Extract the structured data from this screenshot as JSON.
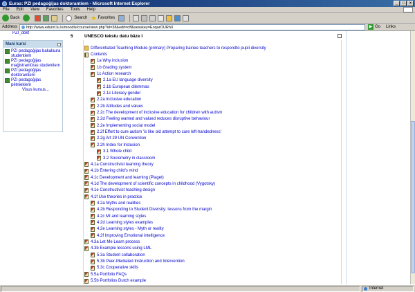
{
  "window": {
    "title": "Euras: PZI pedagoģijas doktorantiem - Microsoft Internet Explorer",
    "minimize": "_",
    "maximize": "□",
    "close": "×"
  },
  "menubar": [
    "File",
    "Edit",
    "View",
    "Favorites",
    "Tools",
    "Help"
  ],
  "toolbar": {
    "back_label": "Back",
    "search_label": "Search",
    "favorites_label": "Favorites"
  },
  "address": {
    "label": "Address",
    "url": "http://www.eduinf.lu.lv/moodle/course/view.php?id=38&edit=off&sesskey=EoqarOURhX",
    "go_label": "Go",
    "links_label": "Links"
  },
  "sidebar": {
    "top_link": "PZI_dokt",
    "block_title": "Mani kursi",
    "courses": [
      "PZI pedagoģijas bakalaura studentiem",
      "PZI pedagoģijas maģistrantūras studentiem",
      "PZI pedagoģijas doktorantiem",
      "PZI pedagoģijas pētniekiem"
    ],
    "all_courses": "Visus kursus..."
  },
  "section": {
    "number": "5",
    "title": "UNESCO tekstu datu bāze I"
  },
  "items": [
    {
      "label": "Differentiated Teaching Module (primary) Preparing trainee teachers to respondto pupil diversity",
      "indent": 0,
      "icon": "folder"
    },
    {
      "label": "Contents",
      "indent": 0,
      "icon": "book"
    },
    {
      "label": "1a Why inclusion",
      "indent": 1,
      "icon": "page"
    },
    {
      "label": "1b Grading system",
      "indent": 1,
      "icon": "page"
    },
    {
      "label": "1c Action research",
      "indent": 1,
      "icon": "page"
    },
    {
      "label": "2.1a EU language diversity",
      "indent": 2,
      "icon": "page"
    },
    {
      "label": "2.1b European dilemmas",
      "indent": 2,
      "icon": "page"
    },
    {
      "label": "2.1c Literacy gender",
      "indent": 2,
      "icon": "page"
    },
    {
      "label": "2.2a Inclusive education",
      "indent": 1,
      "icon": "page"
    },
    {
      "label": "2.2b Attitudes and values",
      "indent": 1,
      "icon": "page"
    },
    {
      "label": "2.2c The development of inclusive education for children with autism",
      "indent": 1,
      "icon": "page"
    },
    {
      "label": "2.2d Feeling wanted and valued reduces disruptive behaviour",
      "indent": 1,
      "icon": "page"
    },
    {
      "label": "2.2e Implementing social model",
      "indent": 1,
      "icon": "page"
    },
    {
      "label": "2.2f Effort to cure autism 'is like old attempt to cure left-handedness'",
      "indent": 1,
      "icon": "page"
    },
    {
      "label": "2.2g Art 29 UN Convention",
      "indent": 1,
      "icon": "page"
    },
    {
      "label": "2.2h Index for Inclusion",
      "indent": 1,
      "icon": "page"
    },
    {
      "label": "3.1 Whole child",
      "indent": 2,
      "icon": "page"
    },
    {
      "label": "3.2 Sociometry in classroom",
      "indent": 2,
      "icon": "page"
    },
    {
      "label": "4.1a Constructivist learning theory",
      "indent": 0,
      "icon": "page"
    },
    {
      "label": "4.1b Entering child's mind",
      "indent": 0,
      "icon": "page"
    },
    {
      "label": "4.1c Development and learning (Piaget)",
      "indent": 0,
      "icon": "page"
    },
    {
      "label": "4.1d The development of scientific concepts in childhood (Vygotsky)",
      "indent": 0,
      "icon": "page"
    },
    {
      "label": "4.1e Constructivist teaching design",
      "indent": 0,
      "icon": "page"
    },
    {
      "label": "4.1f Use theories in practice",
      "indent": 0,
      "icon": "page"
    },
    {
      "label": "4.2a Myths and realities",
      "indent": 1,
      "icon": "page"
    },
    {
      "label": "4.2b Responding to Student Diversity: lessons from the margin",
      "indent": 1,
      "icon": "page"
    },
    {
      "label": "4.2c MI and learning styles",
      "indent": 1,
      "icon": "page"
    },
    {
      "label": "4.2d Learning styles examples",
      "indent": 1,
      "icon": "page"
    },
    {
      "label": "4.2e Learning styles - Myth or reality",
      "indent": 1,
      "icon": "page"
    },
    {
      "label": "4.2f Improving Emotional intelligence",
      "indent": 1,
      "icon": "page"
    },
    {
      "label": "4.3a Let Me Learn process",
      "indent": 0,
      "icon": "page"
    },
    {
      "label": "4.3b Example lessons using LML",
      "indent": 0,
      "icon": "page"
    },
    {
      "label": "5.3a Student collaboration",
      "indent": 1,
      "icon": "page"
    },
    {
      "label": "5.3b Peer-Mediated Instruction and Intervention",
      "indent": 1,
      "icon": "page"
    },
    {
      "label": "5.3c Cooperative skills",
      "indent": 1,
      "icon": "page"
    },
    {
      "label": "5.5a Portfolio FAQs",
      "indent": 0,
      "icon": "page"
    },
    {
      "label": "5.5b Portfolios Dutch example",
      "indent": 0,
      "icon": "page"
    }
  ],
  "status": {
    "text": "",
    "zone": "Internet"
  }
}
